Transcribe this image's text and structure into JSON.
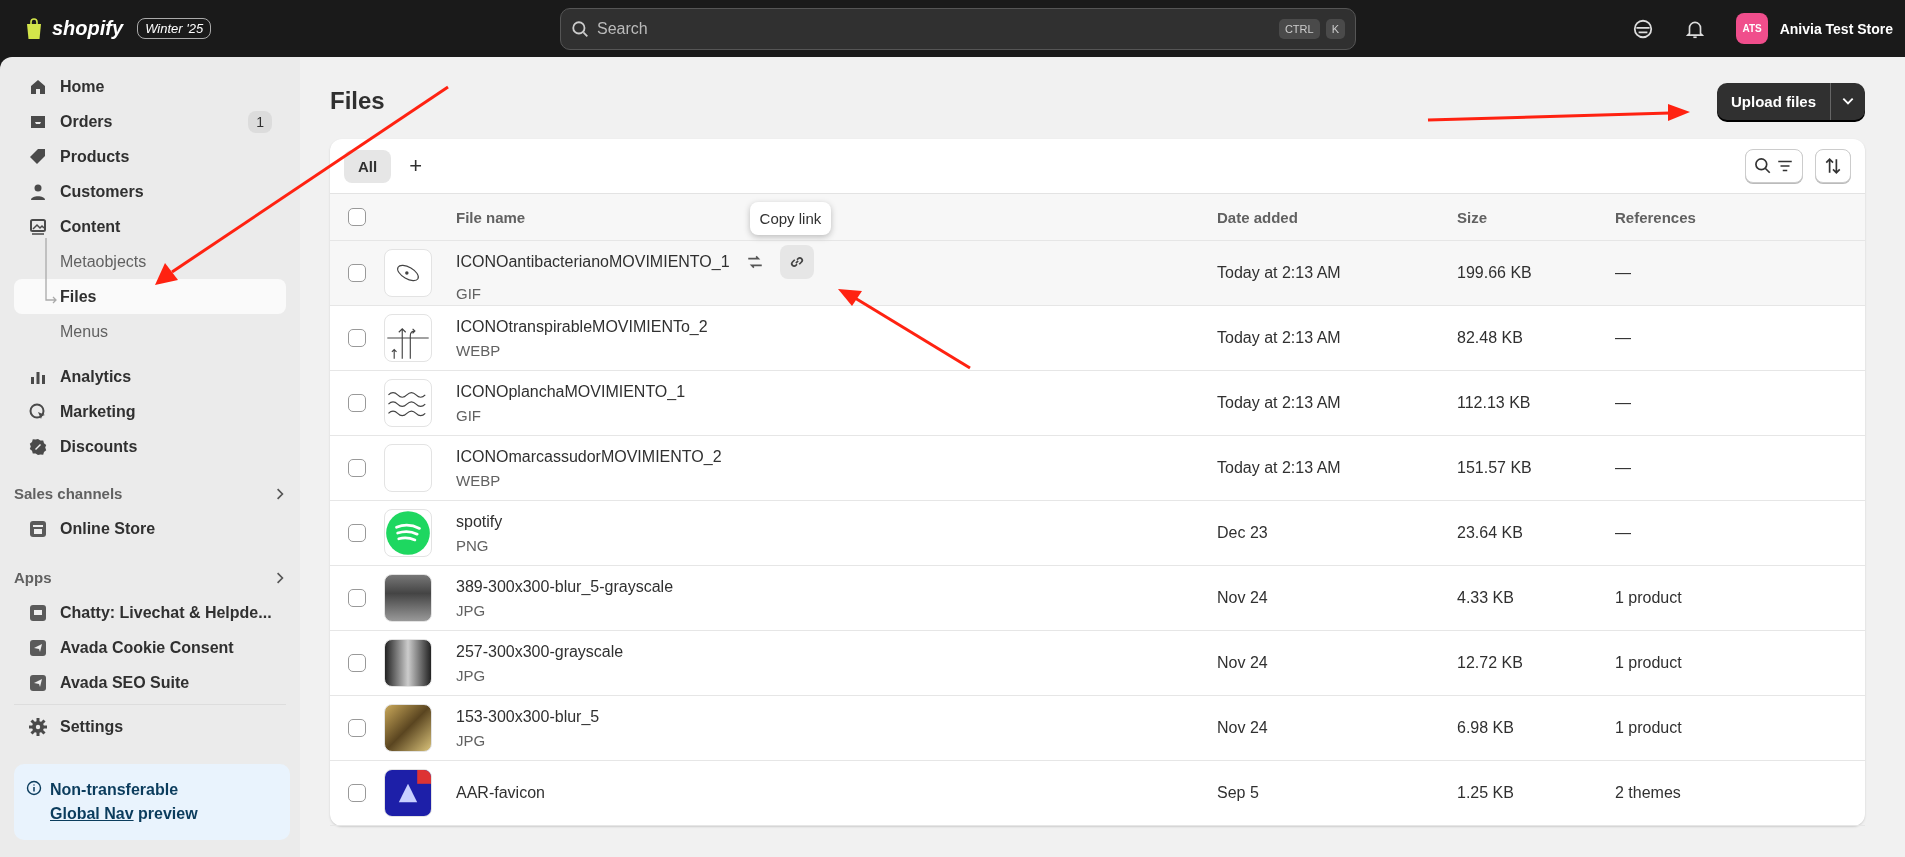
{
  "topbar": {
    "logo": "shopify",
    "edition": "Winter '25",
    "search": {
      "placeholder": "Search"
    },
    "shortcut": [
      "CTRL",
      "K"
    ],
    "avatar": "ATS",
    "store": "Anivia Test Store"
  },
  "sidebar": {
    "nav": [
      {
        "kind": "home",
        "label": "Home",
        "selected": false
      },
      {
        "kind": "orders",
        "label": "Orders",
        "selected": false,
        "badge": "1"
      },
      {
        "kind": "products",
        "label": "Products",
        "selected": false
      },
      {
        "kind": "customers",
        "label": "Customers",
        "selected": false
      },
      {
        "kind": "content",
        "label": "Content",
        "selected": false,
        "children": [
          {
            "label": "Metaobjects",
            "selected": false
          },
          {
            "label": "Files",
            "selected": true
          },
          {
            "label": "Menus",
            "selected": false
          }
        ]
      },
      {
        "kind": "analytics",
        "label": "Analytics",
        "selected": false
      },
      {
        "kind": "marketing",
        "label": "Marketing",
        "selected": false
      },
      {
        "kind": "discounts",
        "label": "Discounts",
        "selected": false
      }
    ],
    "sections": [
      {
        "title": "Sales channels",
        "items": [
          {
            "kind": "store",
            "label": "Online Store"
          }
        ]
      },
      {
        "title": "Apps",
        "items": [
          {
            "kind": "chat",
            "label": "Chatty: Livechat & Helpde..."
          },
          {
            "kind": "plane",
            "label": "Avada Cookie Consent"
          },
          {
            "kind": "plane",
            "label": "Avada SEO Suite"
          }
        ]
      }
    ],
    "settings": "Settings",
    "notice": {
      "text": "Non-transferable",
      "link": "Global Nav",
      "rest": "preview"
    }
  },
  "page": {
    "title": "Files",
    "upload": "Upload files"
  },
  "tabs": [
    {
      "label": "All",
      "selected": true
    }
  ],
  "add_tab": "+",
  "table": {
    "columns": [
      "File name",
      "Date added",
      "Size",
      "References"
    ],
    "header_checked": false,
    "rows": [
      {
        "kind": "germ",
        "name": "ICONOantibacterianoMOVIMIENTO_1",
        "type": "GIF",
        "date": "Today at 2:13 AM",
        "size": "199.66 KB",
        "references": "—",
        "checked": false,
        "hovered": true,
        "tooltip": "Copy link"
      },
      {
        "kind": "arrows",
        "name": "ICONOtranspirableMOVIMIENTo_2",
        "type": "WEBP",
        "date": "Today at 2:13 AM",
        "size": "82.48 KB",
        "references": "—",
        "checked": false,
        "hovered": false
      },
      {
        "kind": "waves",
        "name": "ICONOplanchaMOVIMIENTO_1",
        "type": "GIF",
        "date": "Today at 2:13 AM",
        "size": "112.13 KB",
        "references": "—",
        "checked": false,
        "hovered": false
      },
      {
        "kind": "blank",
        "name": "ICONOmarcassudorMOVIMIENTO_2",
        "type": "WEBP",
        "date": "Today at 2:13 AM",
        "size": "151.57 KB",
        "references": "—",
        "checked": false,
        "hovered": false
      },
      {
        "kind": "spotify",
        "name": "spotify",
        "type": "PNG",
        "date": "Dec 23",
        "size": "23.64 KB",
        "references": "—",
        "checked": false,
        "hovered": false
      },
      {
        "kind": "photo-gray",
        "name": "389-300x300-blur_5-grayscale",
        "type": "JPG",
        "date": "Nov 24",
        "size": "4.33 KB",
        "references": "1 product",
        "checked": false,
        "hovered": false
      },
      {
        "kind": "photo-dark",
        "name": "257-300x300-grayscale",
        "type": "JPG",
        "date": "Nov 24",
        "size": "12.72 KB",
        "references": "1 product",
        "checked": false,
        "hovered": false
      },
      {
        "kind": "photo-warm",
        "name": "153-300x300-blur_5",
        "type": "JPG",
        "date": "Nov 24",
        "size": "6.98 KB",
        "references": "1 product",
        "checked": false,
        "hovered": false
      },
      {
        "kind": "favicon",
        "name": "AAR-favicon",
        "date": "Sep 5",
        "size": "1.25 KB",
        "references": "2 themes",
        "checked": false,
        "hovered": false
      }
    ]
  }
}
